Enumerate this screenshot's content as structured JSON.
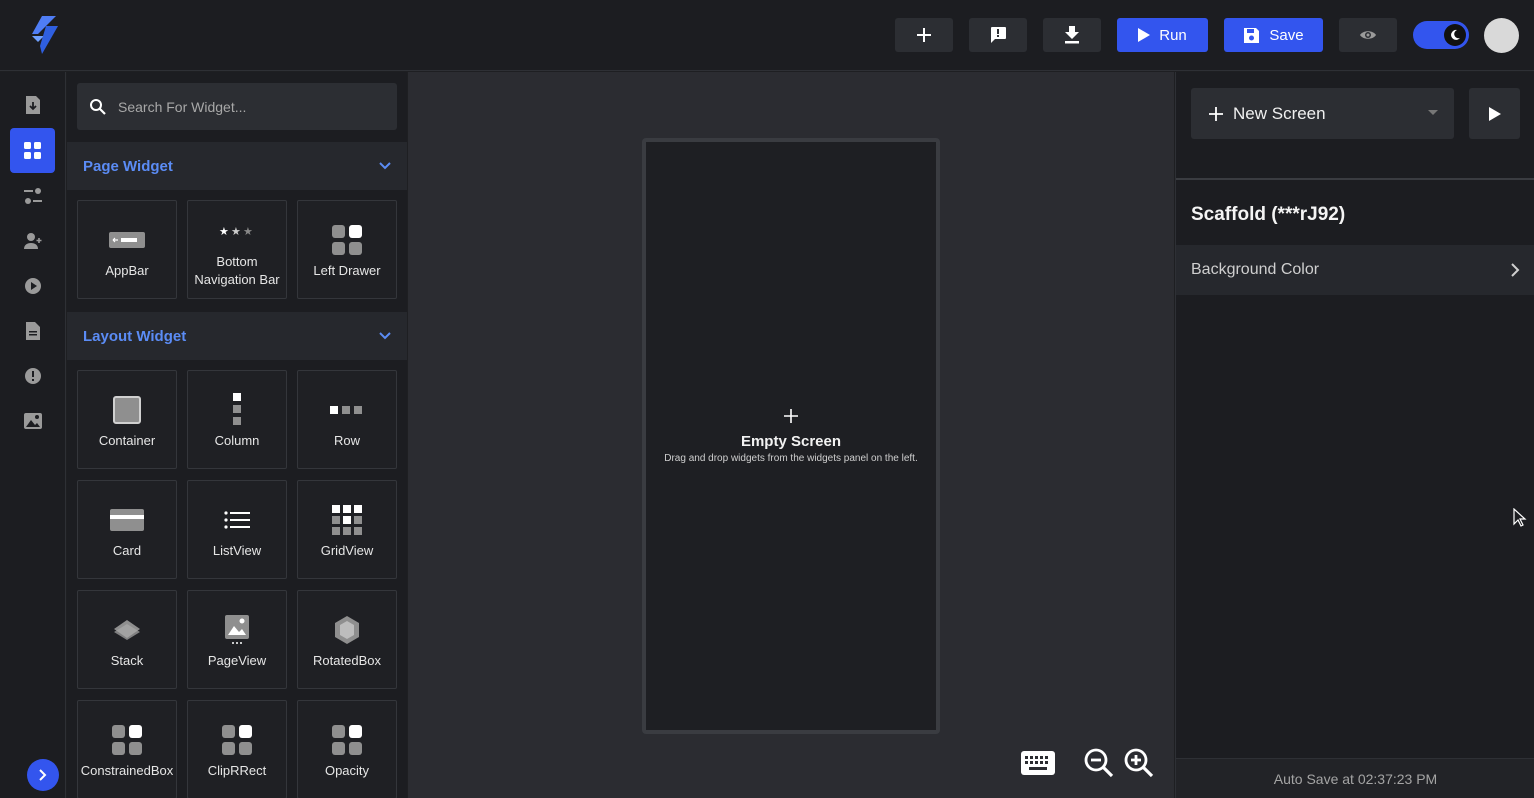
{
  "topbar": {
    "run_label": "Run",
    "save_label": "Save"
  },
  "search": {
    "placeholder": "Search For Widget..."
  },
  "sections": {
    "page": {
      "title": "Page Widget",
      "items": [
        "AppBar",
        "Bottom Navigation Bar",
        "Left Drawer"
      ]
    },
    "layout": {
      "title": "Layout Widget",
      "items": [
        "Container",
        "Column",
        "Row",
        "Card",
        "ListView",
        "GridView",
        "Stack",
        "PageView",
        "RotatedBox",
        "ConstrainedBox",
        "ClipRRect",
        "Opacity"
      ]
    }
  },
  "canvas": {
    "empty_title": "Empty Screen",
    "empty_subtitle": "Drag and drop widgets from the widgets panel on the left."
  },
  "right_panel": {
    "new_screen_label": "New Screen",
    "scaffold_title": "Scaffold (***rJ92)",
    "background_color_label": "Background Color",
    "autosave": "Auto Save at 02:37:23 PM"
  },
  "colors": {
    "accent": "#3355ee",
    "section_title": "#5b8cf5",
    "background": "#1c1d21",
    "canvas": "#2b2c31"
  }
}
